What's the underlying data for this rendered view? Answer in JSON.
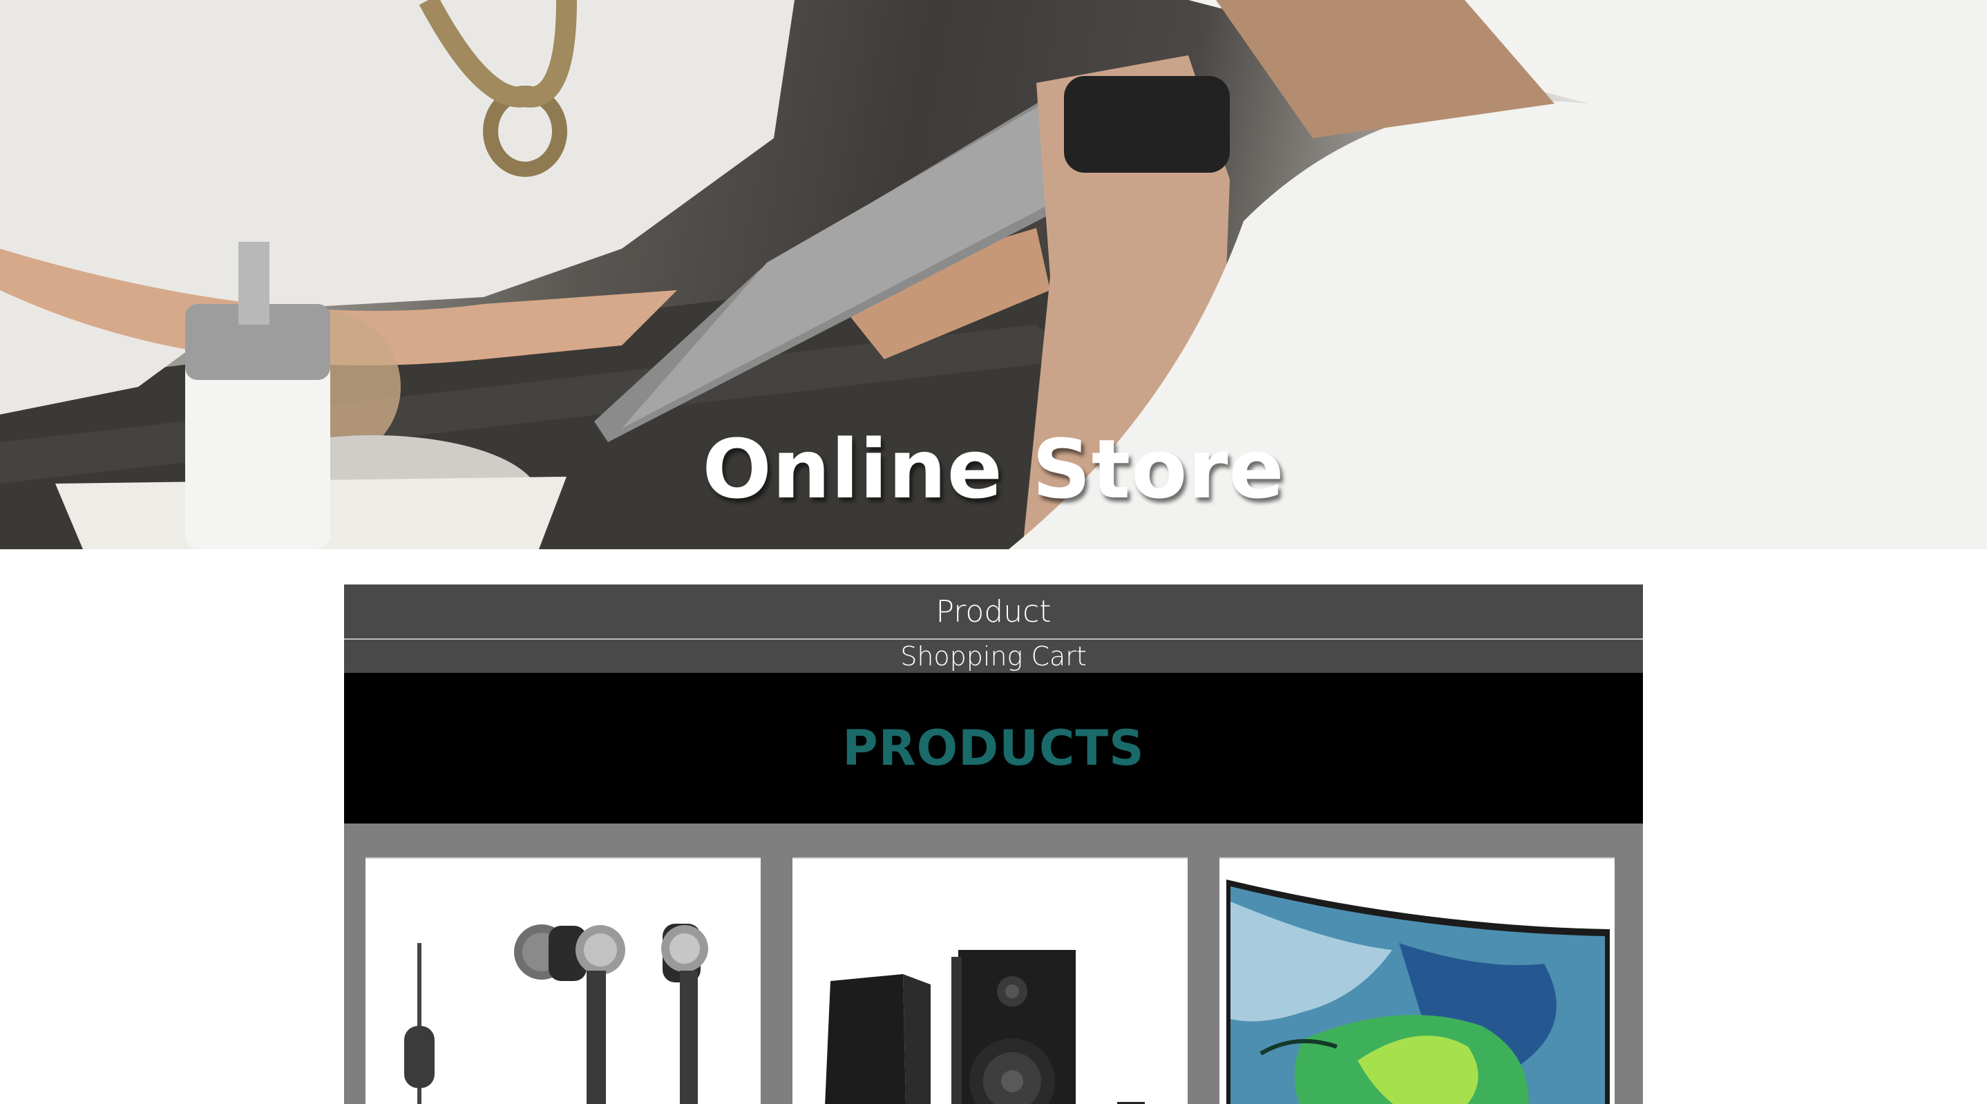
{
  "hero": {
    "title": "Online Store",
    "image": "people-with-tablet-at-cafe-table"
  },
  "nav": {
    "items": [
      {
        "label": "Product"
      },
      {
        "label": "Shopping Cart"
      }
    ]
  },
  "products_section": {
    "heading": "PRODUCTS",
    "heading_color": "#1a6a6a",
    "cards": [
      {
        "image": "earphones-image"
      },
      {
        "image": "speakers-image"
      },
      {
        "image": "curved-tv-image"
      }
    ]
  },
  "colors": {
    "nav_bg": "#494949",
    "banner_bg": "#000000",
    "grid_bg": "#7f7f7f"
  }
}
